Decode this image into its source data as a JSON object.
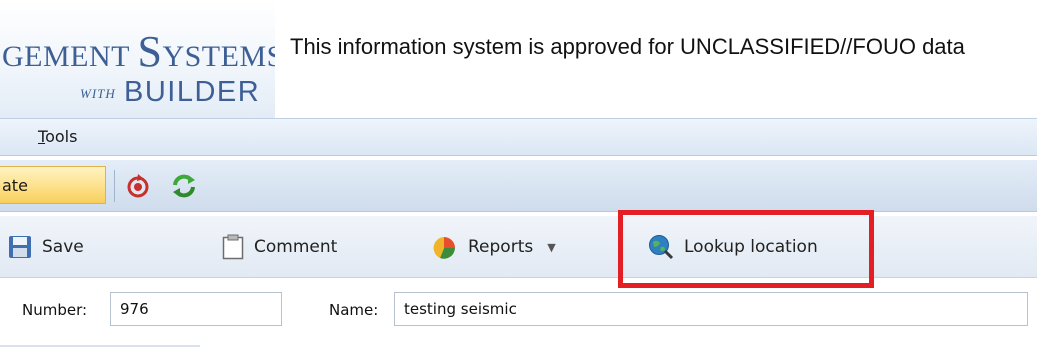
{
  "header": {
    "logo": {
      "line1_prefix": "GEMENT ",
      "line1_cap": "S",
      "line1_rest": "YSTEMS",
      "with": "WITH",
      "builder": "BUILDER"
    },
    "banner": "This information system is approved for UNCLASSIFIED//FOUO data"
  },
  "menu": {
    "tools_accel": "T",
    "tools_rest": "ools"
  },
  "toolbar1": {
    "state_value": "ate",
    "icons": [
      "refresh-red-icon",
      "sync-green-icon"
    ]
  },
  "toolbar2": {
    "save": "Save",
    "comment": "Comment",
    "reports": "Reports",
    "reports_caret": "▼",
    "lookup": "Lookup location"
  },
  "form": {
    "number_label": "Number:",
    "number_value": "976",
    "name_label": "Name:",
    "name_value": "testing seismic"
  },
  "colors": {
    "accent": "#3d5f95",
    "highlight": "#e41e25",
    "state_fill": "#fde08a"
  }
}
